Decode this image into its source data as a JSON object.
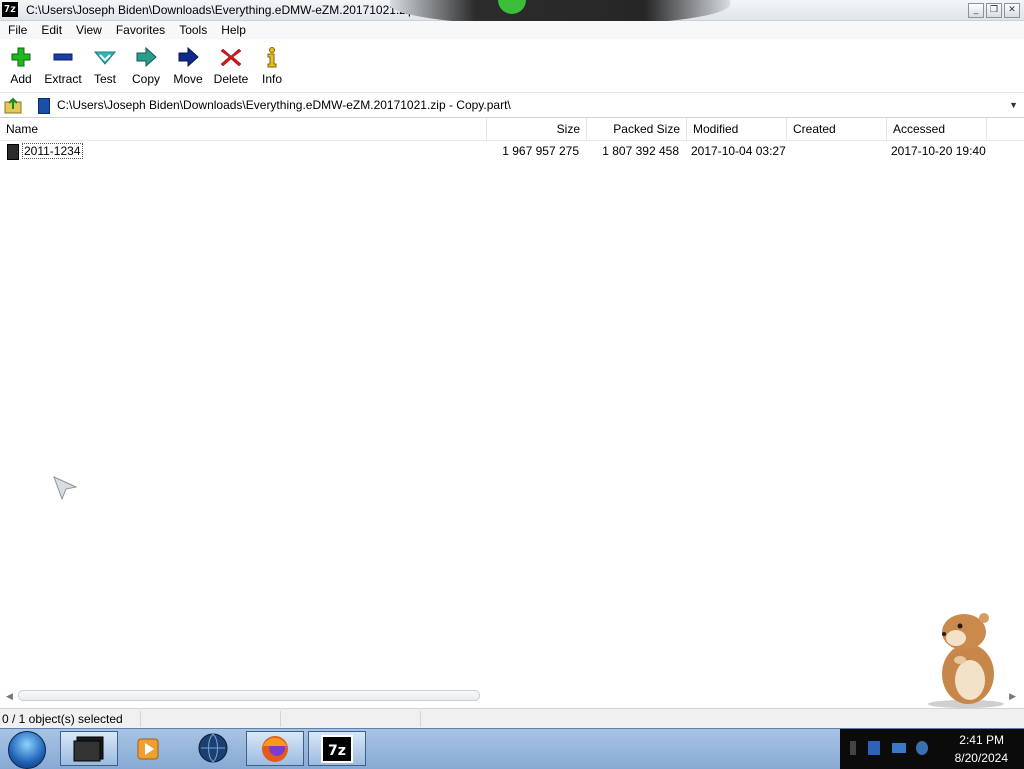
{
  "window": {
    "title": "C:\\Users\\Joseph Biden\\Downloads\\Everything.eDMW-eZM.20171021.zip",
    "app_icon_text": "7z"
  },
  "menu": [
    "File",
    "Edit",
    "View",
    "Favorites",
    "Tools",
    "Help"
  ],
  "toolbar": {
    "add": "Add",
    "extract": "Extract",
    "test": "Test",
    "copy": "Copy",
    "move": "Move",
    "delete": "Delete",
    "info": "Info"
  },
  "address": {
    "path": "C:\\Users\\Joseph Biden\\Downloads\\Everything.eDMW-eZM.20171021.zip - Copy.part\\"
  },
  "columns": {
    "name": "Name",
    "size": "Size",
    "packed_size": "Packed Size",
    "modified": "Modified",
    "created": "Created",
    "accessed": "Accessed"
  },
  "rows": [
    {
      "name": "2011-1234",
      "size": "1 967 957 275",
      "packed_size": "1 807 392 458",
      "modified": "2017-10-04 03:27",
      "created": "",
      "accessed": "2017-10-20 19:40"
    }
  ],
  "status": {
    "selection": "0 / 1 object(s) selected"
  },
  "taskbar": {
    "clock_time": "2:41 PM",
    "clock_date": "8/20/2024",
    "app_7z_label": "7z"
  },
  "colors": {
    "add_green": "#1fb81f",
    "extract_blue": "#1c3ea8",
    "test_cyan": "#31b5b5",
    "copy_teal": "#2a9d8f",
    "move_navy": "#0f2a8a",
    "delete_red": "#d01818",
    "info_yellow": "#e8c21a"
  }
}
